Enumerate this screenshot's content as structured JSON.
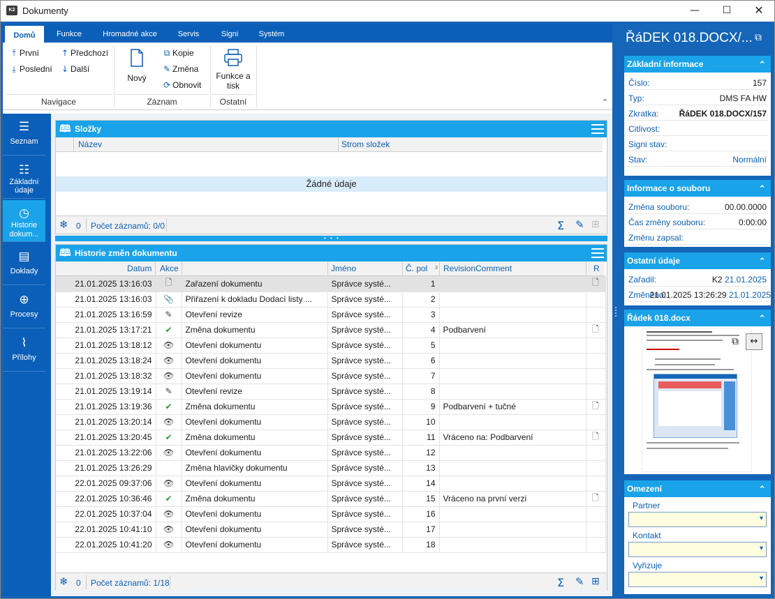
{
  "window": {
    "title": "Dokumenty",
    "icon_text": "K2"
  },
  "ribbon": {
    "tabs": [
      "Domů",
      "Funkce",
      "Hromadné akce",
      "Servis",
      "Signi",
      "Systém"
    ],
    "active_tab": "Domů",
    "nav": {
      "first": "První",
      "last": "Poslední",
      "prev": "Předchozí",
      "next": "Další",
      "group": "Navigace"
    },
    "record": {
      "new": "Nový",
      "copy": "Kopie",
      "change": "Změna",
      "refresh": "Obnovit",
      "group": "Záznam"
    },
    "other": {
      "functions_print_1": "Funkce a",
      "functions_print_2": "tisk",
      "group": "Ostatní"
    }
  },
  "sidenav": [
    {
      "label": "Seznam",
      "icon": "hamburger-icon"
    },
    {
      "label": "Základní údaje",
      "icon": "list-icon"
    },
    {
      "label": "Historie dokum...",
      "icon": "clock-icon",
      "active": true
    },
    {
      "label": "Doklady",
      "icon": "document-icon"
    },
    {
      "label": "Procesy",
      "icon": "arrow-circle-icon"
    },
    {
      "label": "Přílohy",
      "icon": "paperclip-icon"
    }
  ],
  "folders": {
    "title": "Složky",
    "columns": [
      "Název",
      "Strom složek"
    ],
    "empty": "Žádné údaje",
    "footer_count": "0",
    "footer_records": "Počet záznamů: 0/0"
  },
  "history": {
    "title": "Historie změn dokumentu",
    "columns": {
      "date": "Datum",
      "action": "Akce",
      "desc": "",
      "name": "Jméno",
      "num": "Č. pol",
      "comment": "RevisionComment",
      "r": "R"
    },
    "rows": [
      {
        "date": "21.01.2025 13:16:03",
        "icon": "doc",
        "desc": "Zařazení dokumentu",
        "name": "Správce systé...",
        "num": "1",
        "comment": "",
        "r": true,
        "selected": true
      },
      {
        "date": "21.01.2025 13:16:03",
        "icon": "clip",
        "desc": "Přiřazení k dokladu Dodací listy ...",
        "name": "Správce systé...",
        "num": "2",
        "comment": "",
        "r": false
      },
      {
        "date": "21.01.2025 13:16:59",
        "icon": "edit",
        "desc": "Otevření revize",
        "name": "Správce systé...",
        "num": "3",
        "comment": "",
        "r": false
      },
      {
        "date": "21.01.2025 13:17:21",
        "icon": "check",
        "desc": "Změna dokumentu",
        "name": "Správce systé...",
        "num": "4",
        "comment": "Podbarvení",
        "r": true
      },
      {
        "date": "21.01.2025 13:18:12",
        "icon": "eye",
        "desc": "Otevření dokumentu",
        "name": "Správce systé...",
        "num": "5",
        "comment": "",
        "r": false
      },
      {
        "date": "21.01.2025 13:18:24",
        "icon": "eye",
        "desc": "Otevření dokumentu",
        "name": "Správce systé...",
        "num": "6",
        "comment": "",
        "r": false
      },
      {
        "date": "21.01.2025 13:18:32",
        "icon": "eye",
        "desc": "Otevření dokumentu",
        "name": "Správce systé...",
        "num": "7",
        "comment": "",
        "r": false
      },
      {
        "date": "21.01.2025 13:19:14",
        "icon": "edit",
        "desc": "Otevření revize",
        "name": "Správce systé...",
        "num": "8",
        "comment": "",
        "r": false
      },
      {
        "date": "21.01.2025 13:19:36",
        "icon": "check",
        "desc": "Změna dokumentu",
        "name": "Správce systé...",
        "num": "9",
        "comment": "Podbarvení + tučné",
        "r": true
      },
      {
        "date": "21.01.2025 13:20:14",
        "icon": "eye",
        "desc": "Otevření dokumentu",
        "name": "Správce systé...",
        "num": "10",
        "comment": "",
        "r": false
      },
      {
        "date": "21.01.2025 13:20:45",
        "icon": "check",
        "desc": "Změna dokumentu",
        "name": "Správce systé...",
        "num": "11",
        "comment": "Vráceno na: Podbarvení",
        "r": true
      },
      {
        "date": "21.01.2025 13:22:06",
        "icon": "eye",
        "desc": "Otevření dokumentu",
        "name": "Správce systé...",
        "num": "12",
        "comment": "",
        "r": false
      },
      {
        "date": "21.01.2025 13:26:29",
        "icon": "",
        "desc": "Změna hlavičky dokumentu",
        "name": "Správce systé...",
        "num": "13",
        "comment": "",
        "r": false
      },
      {
        "date": "22.01.2025 09:37:06",
        "icon": "eye",
        "desc": "Otevření dokumentu",
        "name": "Správce systé...",
        "num": "14",
        "comment": "",
        "r": false
      },
      {
        "date": "22.01.2025 10:36:46",
        "icon": "check",
        "desc": "Změna dokumentu",
        "name": "Správce systé...",
        "num": "15",
        "comment": "Vráceno na první verzi",
        "r": true
      },
      {
        "date": "22.01.2025 10:37:04",
        "icon": "eye",
        "desc": "Otevření dokumentu",
        "name": "Správce systé...",
        "num": "16",
        "comment": "",
        "r": false
      },
      {
        "date": "22.01.2025 10:41:10",
        "icon": "eye",
        "desc": "Otevření dokumentu",
        "name": "Správce systé...",
        "num": "17",
        "comment": "",
        "r": false
      },
      {
        "date": "22.01.2025 10:41:20",
        "icon": "eye",
        "desc": "Otevření dokumentu",
        "name": "Správce systé...",
        "num": "18",
        "comment": "",
        "r": false
      }
    ],
    "footer_count": "0",
    "footer_records": "Počet záznamů: 1/18"
  },
  "right": {
    "title": "ŘáDEK 018.DOCX/...",
    "basic": {
      "title": "Základní informace",
      "rows": [
        {
          "k": "Číslo:",
          "v": "157"
        },
        {
          "k": "Typ:",
          "v": "DMS FA HW"
        },
        {
          "k": "Zkratka:",
          "v": "ŘáDEK 018.DOCX/157"
        },
        {
          "k": "Citlivost:",
          "v": ""
        },
        {
          "k": "Signi stav:",
          "v": ""
        },
        {
          "k": "Stav:",
          "v": "Normální"
        }
      ]
    },
    "file": {
      "title": "Informace o souboru",
      "rows": [
        {
          "k": "Změna souboru:",
          "v": "00.00.0000"
        },
        {
          "k": "Čas změny souboru:",
          "v": "0:00:00"
        },
        {
          "k": "Změnu zapsal:",
          "v": ""
        }
      ]
    },
    "other": {
      "title": "Ostatní údaje",
      "filed_label": "Zařadil:",
      "filed_user": "K2",
      "filed_date": "21.01.2025",
      "changed_label": "Změněno:",
      "changed_value": "21.01.2025 13:26:29",
      "changed_date": "21.01.2025"
    },
    "preview": {
      "title": "Řádek 018.docx"
    },
    "limits": {
      "title": "Omezení",
      "partner": "Partner",
      "contact": "Kontakt",
      "handler": "Vyřizuje"
    }
  }
}
